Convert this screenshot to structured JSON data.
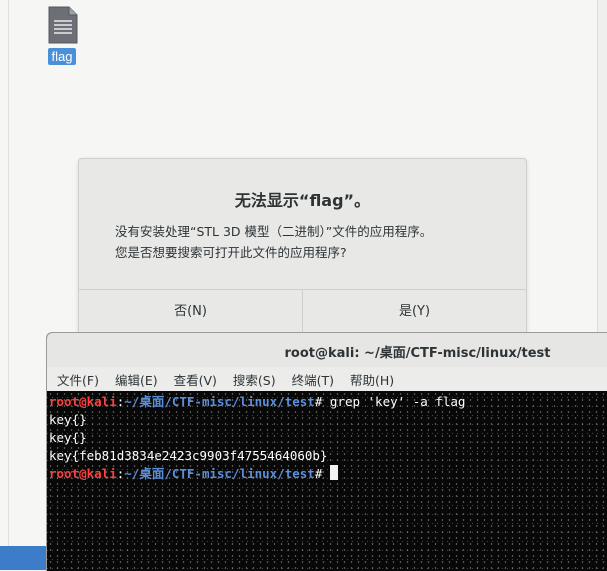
{
  "desktop": {
    "file": {
      "label": "flag",
      "icon": "text-file-icon"
    }
  },
  "dialog": {
    "title": "无法显示“flag”。",
    "message_line1": "没有安装处理“STL 3D 模型（二进制）”文件的应用程序。",
    "message_line2": "您是否想要搜索可打开此文件的应用程序?",
    "no_label": "否(N)",
    "yes_label": "是(Y)"
  },
  "terminal": {
    "title": "root@kali: ~/桌面/CTF-misc/linux/test",
    "menu": [
      "文件(F)",
      "编辑(E)",
      "查看(V)",
      "搜索(S)",
      "终端(T)",
      "帮助(H)"
    ],
    "prompt_user": "root@kali",
    "prompt_sep": ":",
    "prompt_path": "~/桌面/CTF-misc/linux/test",
    "prompt_symbol": "# ",
    "command": "grep 'key' -a flag",
    "outputs": [
      "key{}",
      "key{}",
      "key{feb81d3834e2423c9903f4755464060b}"
    ]
  },
  "colors": {
    "prompt_user": "#ff4040",
    "prompt_path": "#5b8fd9",
    "selection": "#4a90d9"
  }
}
